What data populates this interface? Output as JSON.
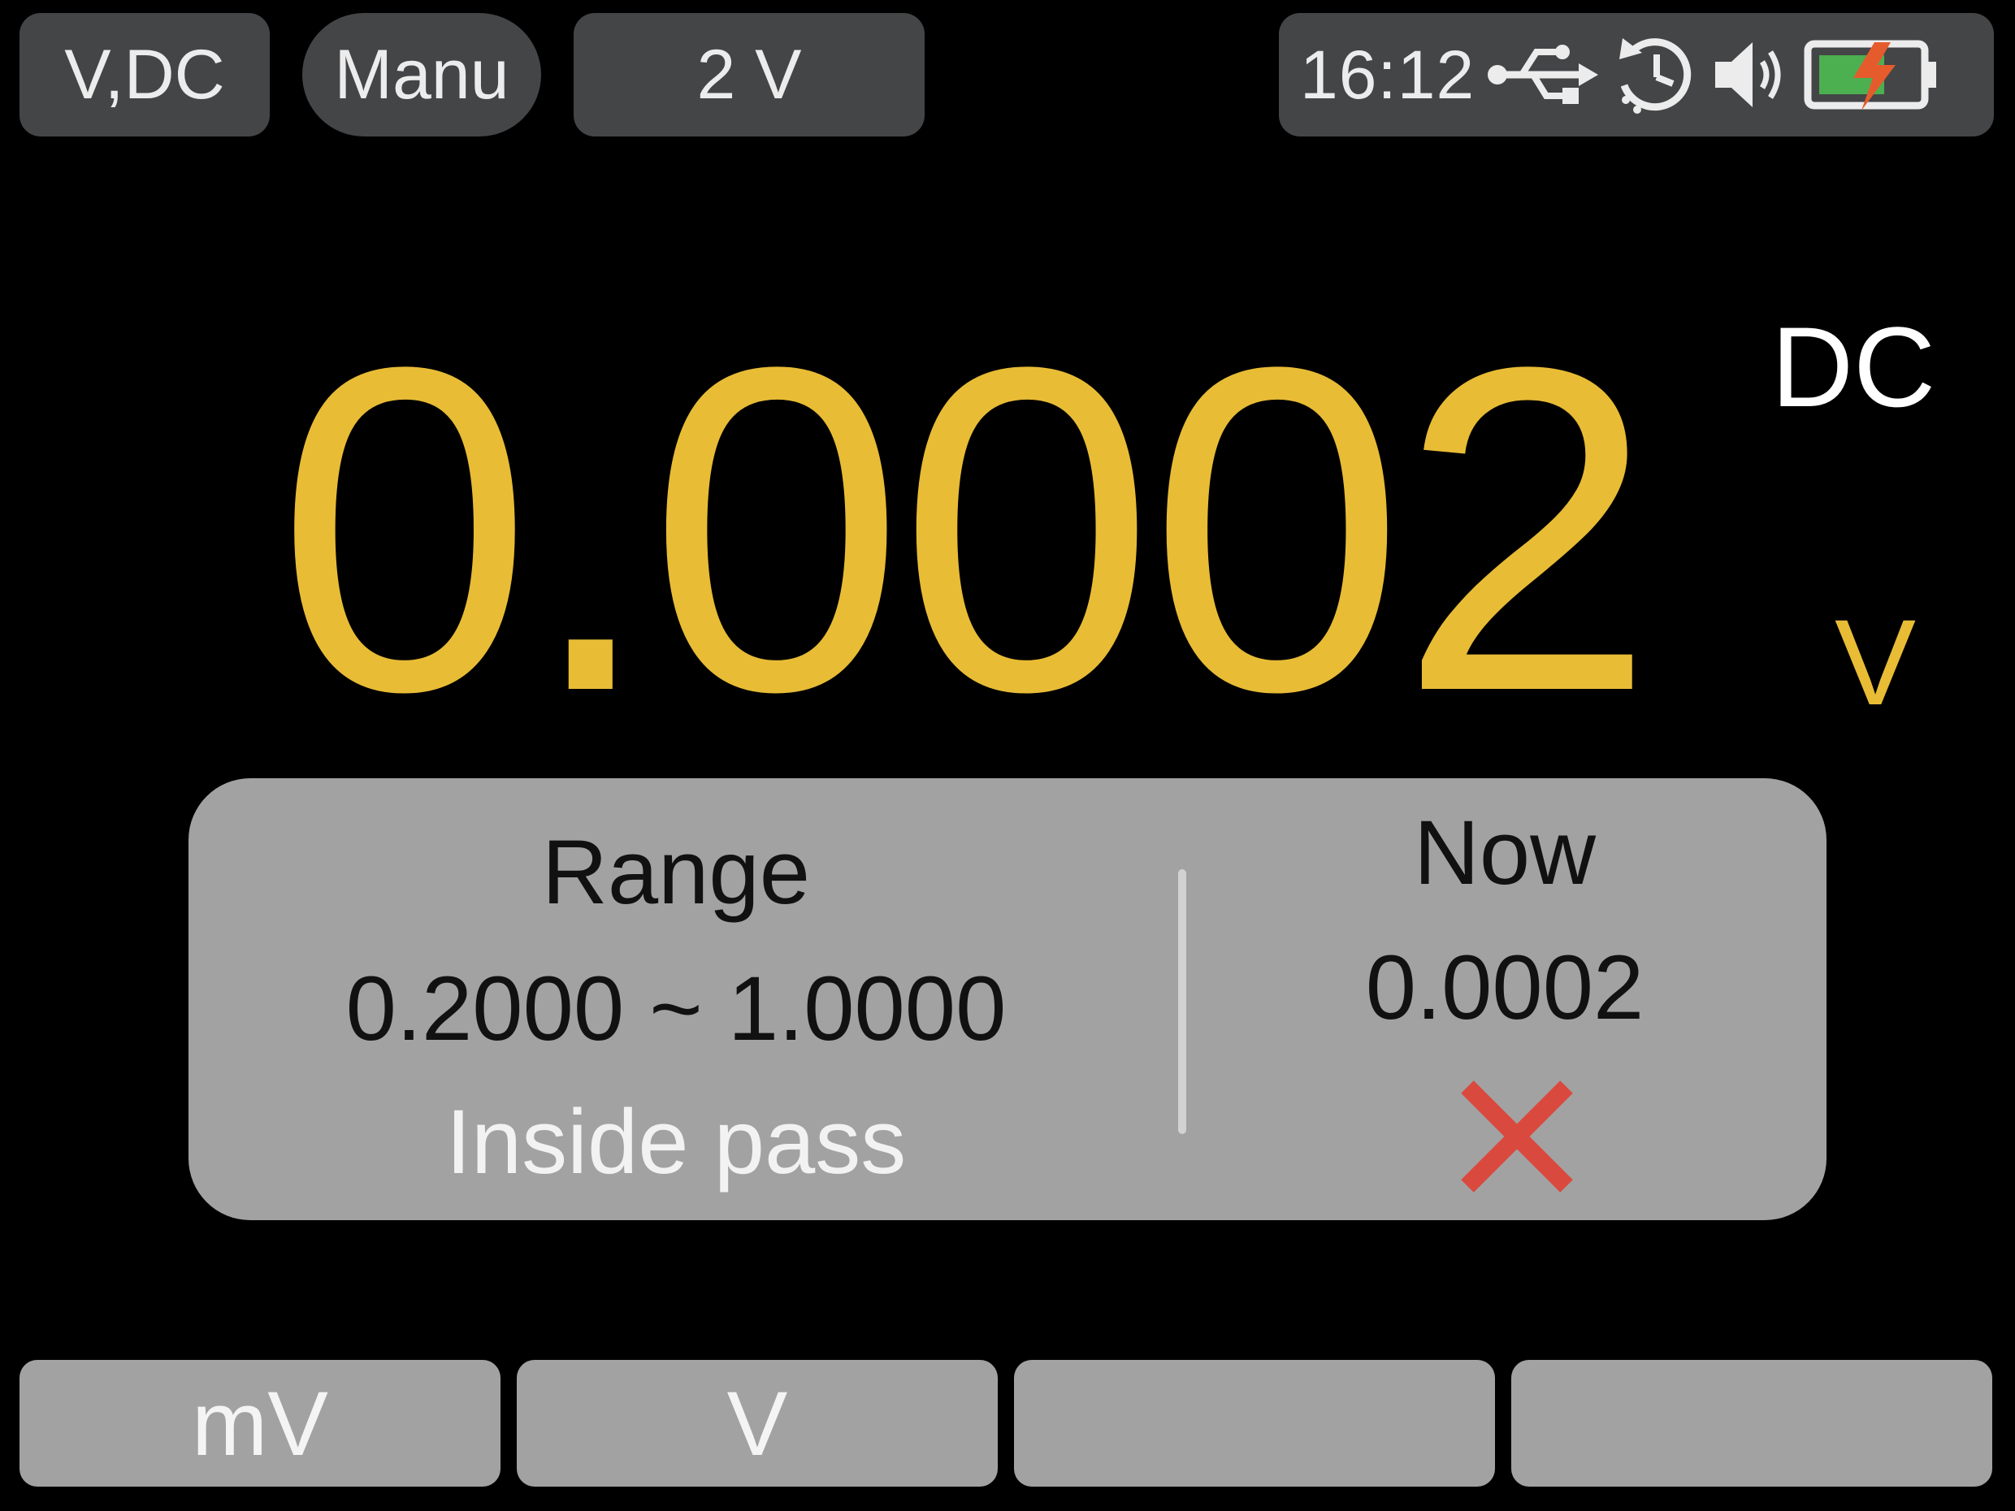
{
  "top_bar": {
    "mode": "V,DC",
    "range_mode": "Manu",
    "range": "2 V"
  },
  "status": {
    "time": "16:12",
    "icons": [
      "usb-icon",
      "timer-icon",
      "speaker-icon",
      "battery-charging-icon"
    ]
  },
  "reading": {
    "value": "0.0002",
    "coupling": "DC",
    "unit": "V"
  },
  "limit": {
    "range_title": "Range",
    "range_value": "0.2000 ~ 1.0000",
    "mode": "Inside pass",
    "now_title": "Now",
    "now_value": "0.0002",
    "result": "fail",
    "fail_color": "#d9493e"
  },
  "softkeys": [
    "mV",
    "V",
    "",
    ""
  ],
  "colors": {
    "reading": "#e8bc35",
    "pill_bg": "#434547",
    "panel_bg": "#a2a2a2"
  }
}
